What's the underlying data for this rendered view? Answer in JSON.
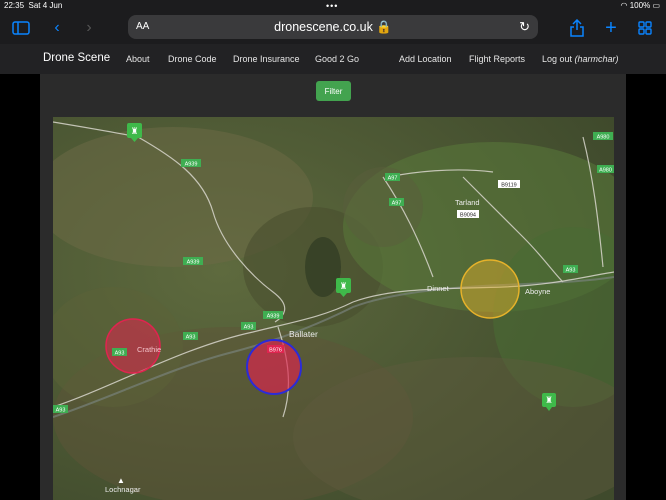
{
  "status": {
    "time": "22:35",
    "date": "Sat 4 Jun",
    "dots": "•••",
    "battery": "100%"
  },
  "browser": {
    "aa": "AA",
    "url": "dronescene.co.uk 🔒"
  },
  "nav": {
    "brand": "Drone Scene",
    "items": [
      "About",
      "Drone Code",
      "Drone Insurance",
      "Good 2 Go",
      "Add Location",
      "Flight Reports",
      "Log out"
    ],
    "user": "(harmchar)"
  },
  "filter_label": "Filter",
  "map": {
    "places": {
      "tarland": "Tarland",
      "dinnet": "Dinnet",
      "aboyne": "Aboyne",
      "ballater": "Ballater",
      "crathie": "Crathie",
      "lochnagar": "Lochnagar"
    },
    "roads": {
      "a939a": "A939",
      "a939b": "A939",
      "a939c": "A939",
      "a97": "A97",
      "a97b": "A97",
      "a93a": "A93",
      "a93b": "A93",
      "a93c": "A93",
      "a93d": "A93",
      "a93e": "A93",
      "a980": "A980",
      "b9119": "B9119",
      "b9094": "B9094",
      "a980b": "A980",
      "b976": "B976"
    },
    "colors": {
      "red_zone": "#e0244f",
      "blue_ring": "#2b2bd9",
      "yellow_zone": "#e6b22a",
      "marker": "#3fb94a"
    }
  }
}
